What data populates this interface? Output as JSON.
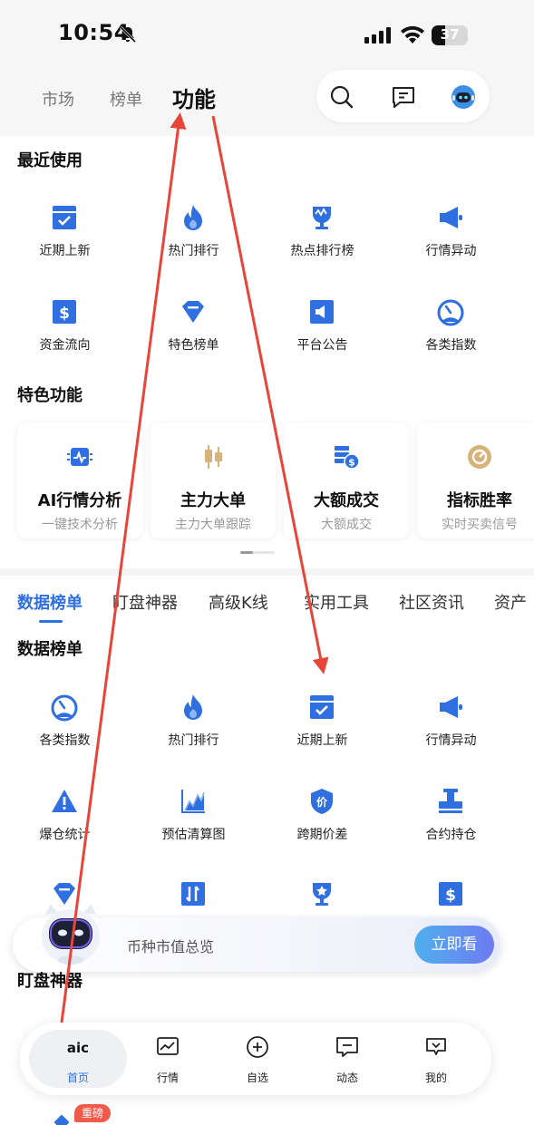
{
  "status_bar": {
    "time": "10:54",
    "battery": "37"
  },
  "top_tabs": [
    {
      "label": "市场",
      "active": false
    },
    {
      "label": "榜单",
      "active": false
    },
    {
      "label": "功能",
      "active": true
    }
  ],
  "top_actions": {
    "icons": [
      "search-icon",
      "message-icon",
      "robot-avatar-icon"
    ]
  },
  "recent": {
    "title": "最近使用",
    "items": [
      {
        "label": "近期上新",
        "icon": "calendar-check-icon"
      },
      {
        "label": "热门排行",
        "icon": "flame-icon"
      },
      {
        "label": "热点排行榜",
        "icon": "trophy-icon"
      },
      {
        "label": "行情异动",
        "icon": "megaphone-icon"
      },
      {
        "label": "资金流向",
        "icon": "dollar-icon"
      },
      {
        "label": "特色榜单",
        "icon": "diamond-icon"
      },
      {
        "label": "平台公告",
        "icon": "speaker-icon"
      },
      {
        "label": "各类指数",
        "icon": "gauge-icon"
      }
    ]
  },
  "features": {
    "title": "特色功能",
    "cards": [
      {
        "title": "AI行情分析",
        "subtitle": "一键技术分析",
        "icon": "ai-chip-icon"
      },
      {
        "title": "主力大单",
        "subtitle": "主力大单跟踪",
        "icon": "candlestick-icon"
      },
      {
        "title": "大额成交",
        "subtitle": "大额成交",
        "icon": "coin-stack-icon"
      },
      {
        "title": "指标胜率",
        "subtitle": "实时买卖信号",
        "icon": "target-badge-icon"
      }
    ]
  },
  "sub_tabs": [
    {
      "label": "数据榜单",
      "active": true
    },
    {
      "label": "盯盘神器",
      "active": false
    },
    {
      "label": "高级K线",
      "active": false
    },
    {
      "label": "实用工具",
      "active": false
    },
    {
      "label": "社区资讯",
      "active": false
    },
    {
      "label": "资产",
      "active": false
    }
  ],
  "data_rank": {
    "title": "数据榜单",
    "items": [
      {
        "label": "各类指数",
        "icon": "gauge-icon"
      },
      {
        "label": "热门排行",
        "icon": "flame-icon"
      },
      {
        "label": "近期上新",
        "icon": "calendar-check-icon"
      },
      {
        "label": "行情异动",
        "icon": "megaphone-icon"
      },
      {
        "label": "爆仓统计",
        "icon": "warning-icon"
      },
      {
        "label": "预估清算图",
        "icon": "chart-icon"
      },
      {
        "label": "跨期价差",
        "icon": "price-shield-icon"
      },
      {
        "label": "合约持仓",
        "icon": "stamp-icon"
      }
    ],
    "partial_icons": [
      "diamond-icon",
      "swap-arrows-icon",
      "trophy-star-icon",
      "dollar-icon"
    ]
  },
  "next_section_title": "盯盘神器",
  "banner": {
    "text": "币种市值总览",
    "button": "立即看"
  },
  "bottom_nav": [
    {
      "label": "首页",
      "icon": "aic-logo-icon",
      "active": true
    },
    {
      "label": "行情",
      "icon": "line-chart-icon",
      "active": false
    },
    {
      "label": "自选",
      "icon": "plus-circle-icon",
      "active": false
    },
    {
      "label": "动态",
      "icon": "chat-icon",
      "active": false
    },
    {
      "label": "我的",
      "icon": "heart-chat-icon",
      "active": false
    }
  ],
  "badge": "重磅",
  "colors": {
    "accent": "#2f6fe0",
    "annotation": "#e8453a",
    "badge": "#f05a4a"
  }
}
